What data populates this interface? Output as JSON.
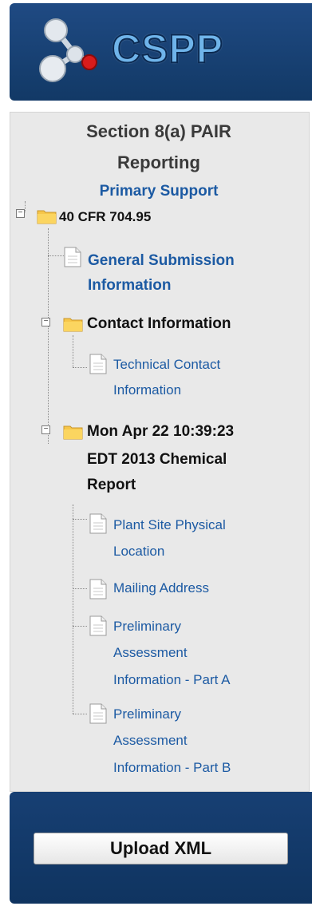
{
  "header": {
    "logo_text": "CSPP"
  },
  "panel": {
    "title_line1": "Section 8(a) PAIR",
    "title_line2": "Reporting",
    "subtitle": "Primary Support"
  },
  "tree": {
    "root": {
      "label": "40 CFR 704.95",
      "expander": "−"
    },
    "general": {
      "label_line1": "General Submission",
      "label_line2": "Information"
    },
    "contact": {
      "label": "Contact Information",
      "expander": "−"
    },
    "technical": {
      "label_line1": "Technical Contact",
      "label_line2": "Information"
    },
    "report": {
      "label_line1": "Mon Apr 22 10:39:23",
      "label_line2": "EDT 2013 Chemical",
      "label_line3": "Report",
      "expander": "−"
    },
    "plant": {
      "label_line1": "Plant Site Physical",
      "label_line2": "Location"
    },
    "mailing": {
      "label": "Mailing Address"
    },
    "part_a": {
      "label_line1": "Preliminary",
      "label_line2": "Assessment",
      "label_line3": "Information - Part A"
    },
    "part_b": {
      "label_line1": "Preliminary",
      "label_line2": "Assessment",
      "label_line3": "Information - Part B"
    }
  },
  "footer": {
    "upload_label": "Upload XML"
  },
  "colors": {
    "header_bg": "#1f4a83",
    "link": "#1c5aa3",
    "panel_bg": "#e9e9e9",
    "logo_text": "#6fb4ea"
  }
}
